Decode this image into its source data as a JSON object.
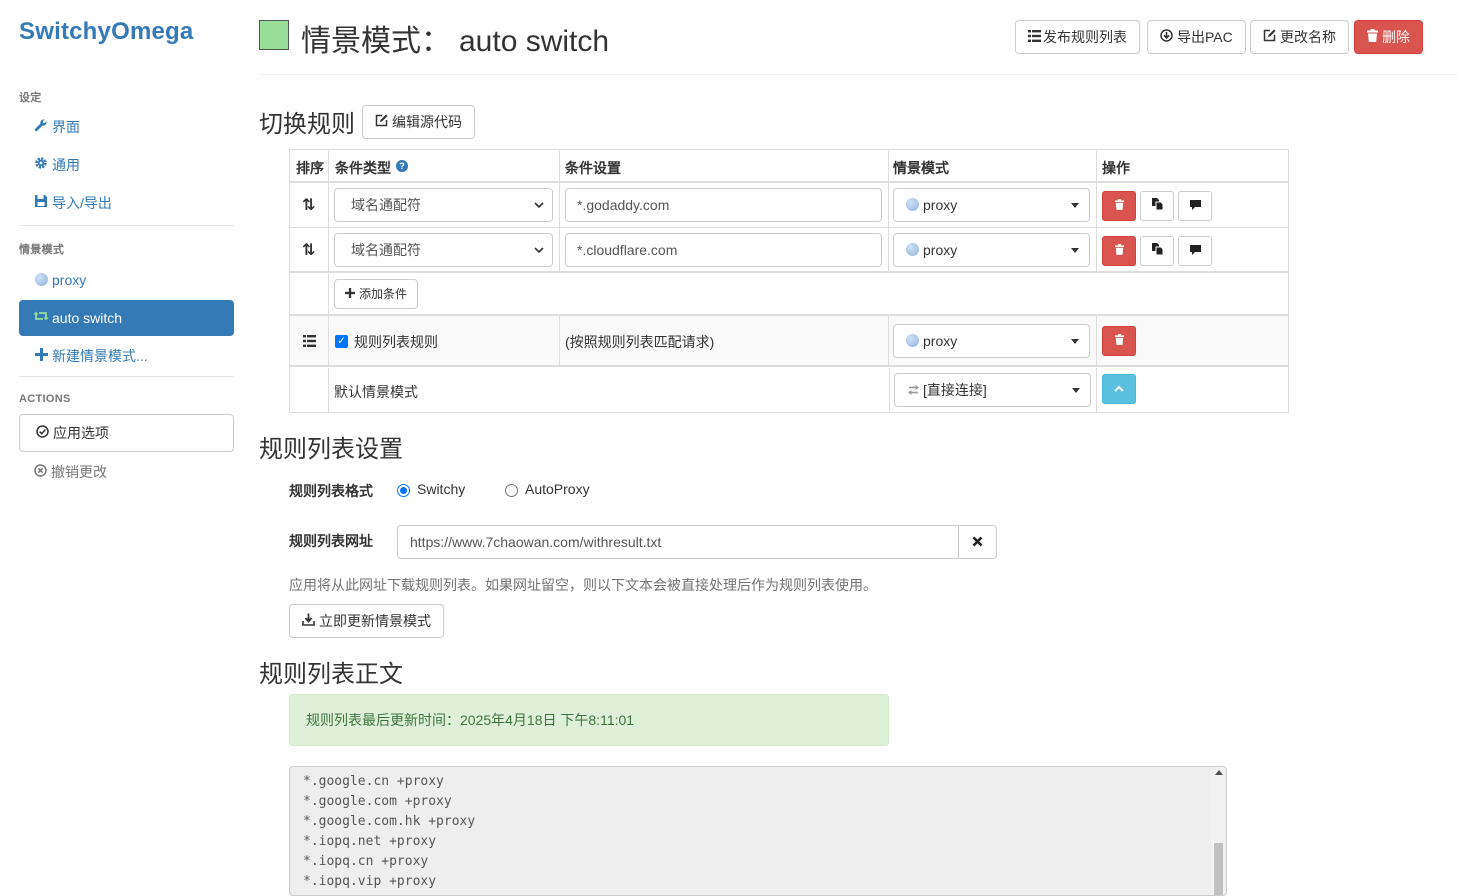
{
  "app": {
    "brand": "SwitchyOmega"
  },
  "sidebar": {
    "settings_header": "设定",
    "settings_items": [
      {
        "label": "界面",
        "icon": "wrench-icon"
      },
      {
        "label": "通用",
        "icon": "gear-icon"
      },
      {
        "label": "导入/导出",
        "icon": "floppy-icon"
      }
    ],
    "profiles_header": "情景模式",
    "profiles": [
      {
        "label": "proxy",
        "icon": "globe-icon"
      },
      {
        "label": "auto switch",
        "icon": "retweet-icon",
        "active": true
      },
      {
        "label": "新建情景模式...",
        "icon": "plus-icon"
      }
    ],
    "actions_header": "ACTIONS",
    "apply_label": "应用选项",
    "discard_label": "撤销更改"
  },
  "header": {
    "title_prefix": "情景模式：",
    "profile_name": "auto switch",
    "profile_color": "#99dd99",
    "buttons": {
      "publish": "发布规则列表",
      "export_pac": "导出PAC",
      "rename": "更改名称",
      "delete": "删除"
    }
  },
  "switch_rules": {
    "title": "切换规则",
    "edit_source": "编辑源代码",
    "columns": {
      "order": "排序",
      "condition_type": "条件类型",
      "condition": "条件设置",
      "profile": "情景模式",
      "actions": "操作"
    },
    "rows": [
      {
        "condition_type": "域名通配符",
        "condition": "*.godaddy.com",
        "profile": "proxy"
      },
      {
        "condition_type": "域名通配符",
        "condition": "*.cloudflare.com",
        "profile": "proxy"
      }
    ],
    "add_condition": "添加条件",
    "rule_list_row": {
      "label": "规则列表规则",
      "checked": true,
      "note": "(按照规则列表匹配请求)",
      "profile": "proxy"
    },
    "default_row": {
      "label": "默认情景模式",
      "profile": "[直接连接]"
    }
  },
  "rule_list_settings": {
    "title": "规则列表设置",
    "format_label": "规则列表格式",
    "formats": [
      {
        "label": "Switchy",
        "checked": true
      },
      {
        "label": "AutoProxy",
        "checked": false
      }
    ],
    "url_label": "规则列表网址",
    "url": "https://www.7chaowan.com/withresult.txt",
    "help": "应用将从此网址下载规则列表。如果网址留空，则以下文本会被直接处理后作为规则列表使用。",
    "update_now": "立即更新情景模式"
  },
  "rule_list_text": {
    "title": "规则列表正文",
    "last_updated": "规则列表最后更新时间：2025年4月18日 下午8:11:01",
    "lines": [
      "*.google.cn +proxy",
      "*.google.com +proxy",
      "*.google.com.hk +proxy",
      "*.iopq.net +proxy",
      "*.iopq.cn +proxy",
      "*.iopq.vip +proxy"
    ]
  },
  "colors": {
    "primary": "#337ab7",
    "danger": "#d9534f",
    "info": "#5bc0de",
    "success_bg": "#dff0d8"
  }
}
